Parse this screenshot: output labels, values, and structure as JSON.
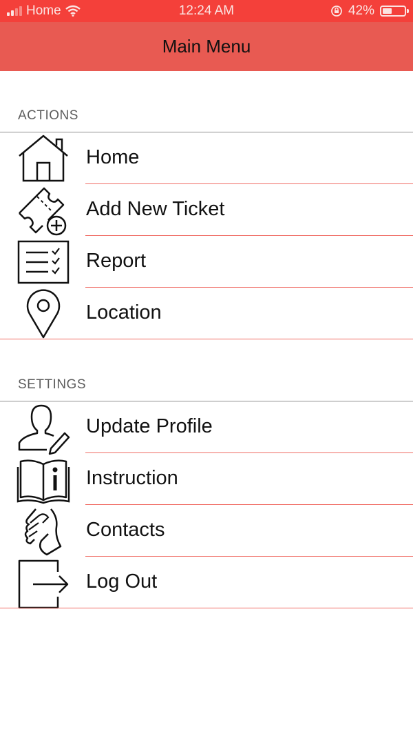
{
  "status_bar": {
    "carrier": "Home",
    "time": "12:24 AM",
    "battery_percent": "42%",
    "battery_level": 0.42,
    "signal_bars": 2
  },
  "nav": {
    "title": "Main Menu"
  },
  "sections": {
    "actions": {
      "header": "ACTIONS",
      "items": [
        {
          "label": "Home",
          "icon": "house-icon"
        },
        {
          "label": "Add New Ticket",
          "icon": "ticket-add-icon"
        },
        {
          "label": "Report",
          "icon": "checklist-icon"
        },
        {
          "label": "Location",
          "icon": "map-pin-icon"
        }
      ]
    },
    "settings": {
      "header": "SETTINGS",
      "items": [
        {
          "label": "Update Profile",
          "icon": "user-edit-icon"
        },
        {
          "label": "Instruction",
          "icon": "book-info-icon"
        },
        {
          "label": "Contacts",
          "icon": "handshake-icon"
        },
        {
          "label": "Log Out",
          "icon": "logout-icon"
        }
      ]
    }
  },
  "colors": {
    "status_bar": "#f4403a",
    "nav_bar": "#e85a52",
    "divider": "#f06a62"
  }
}
